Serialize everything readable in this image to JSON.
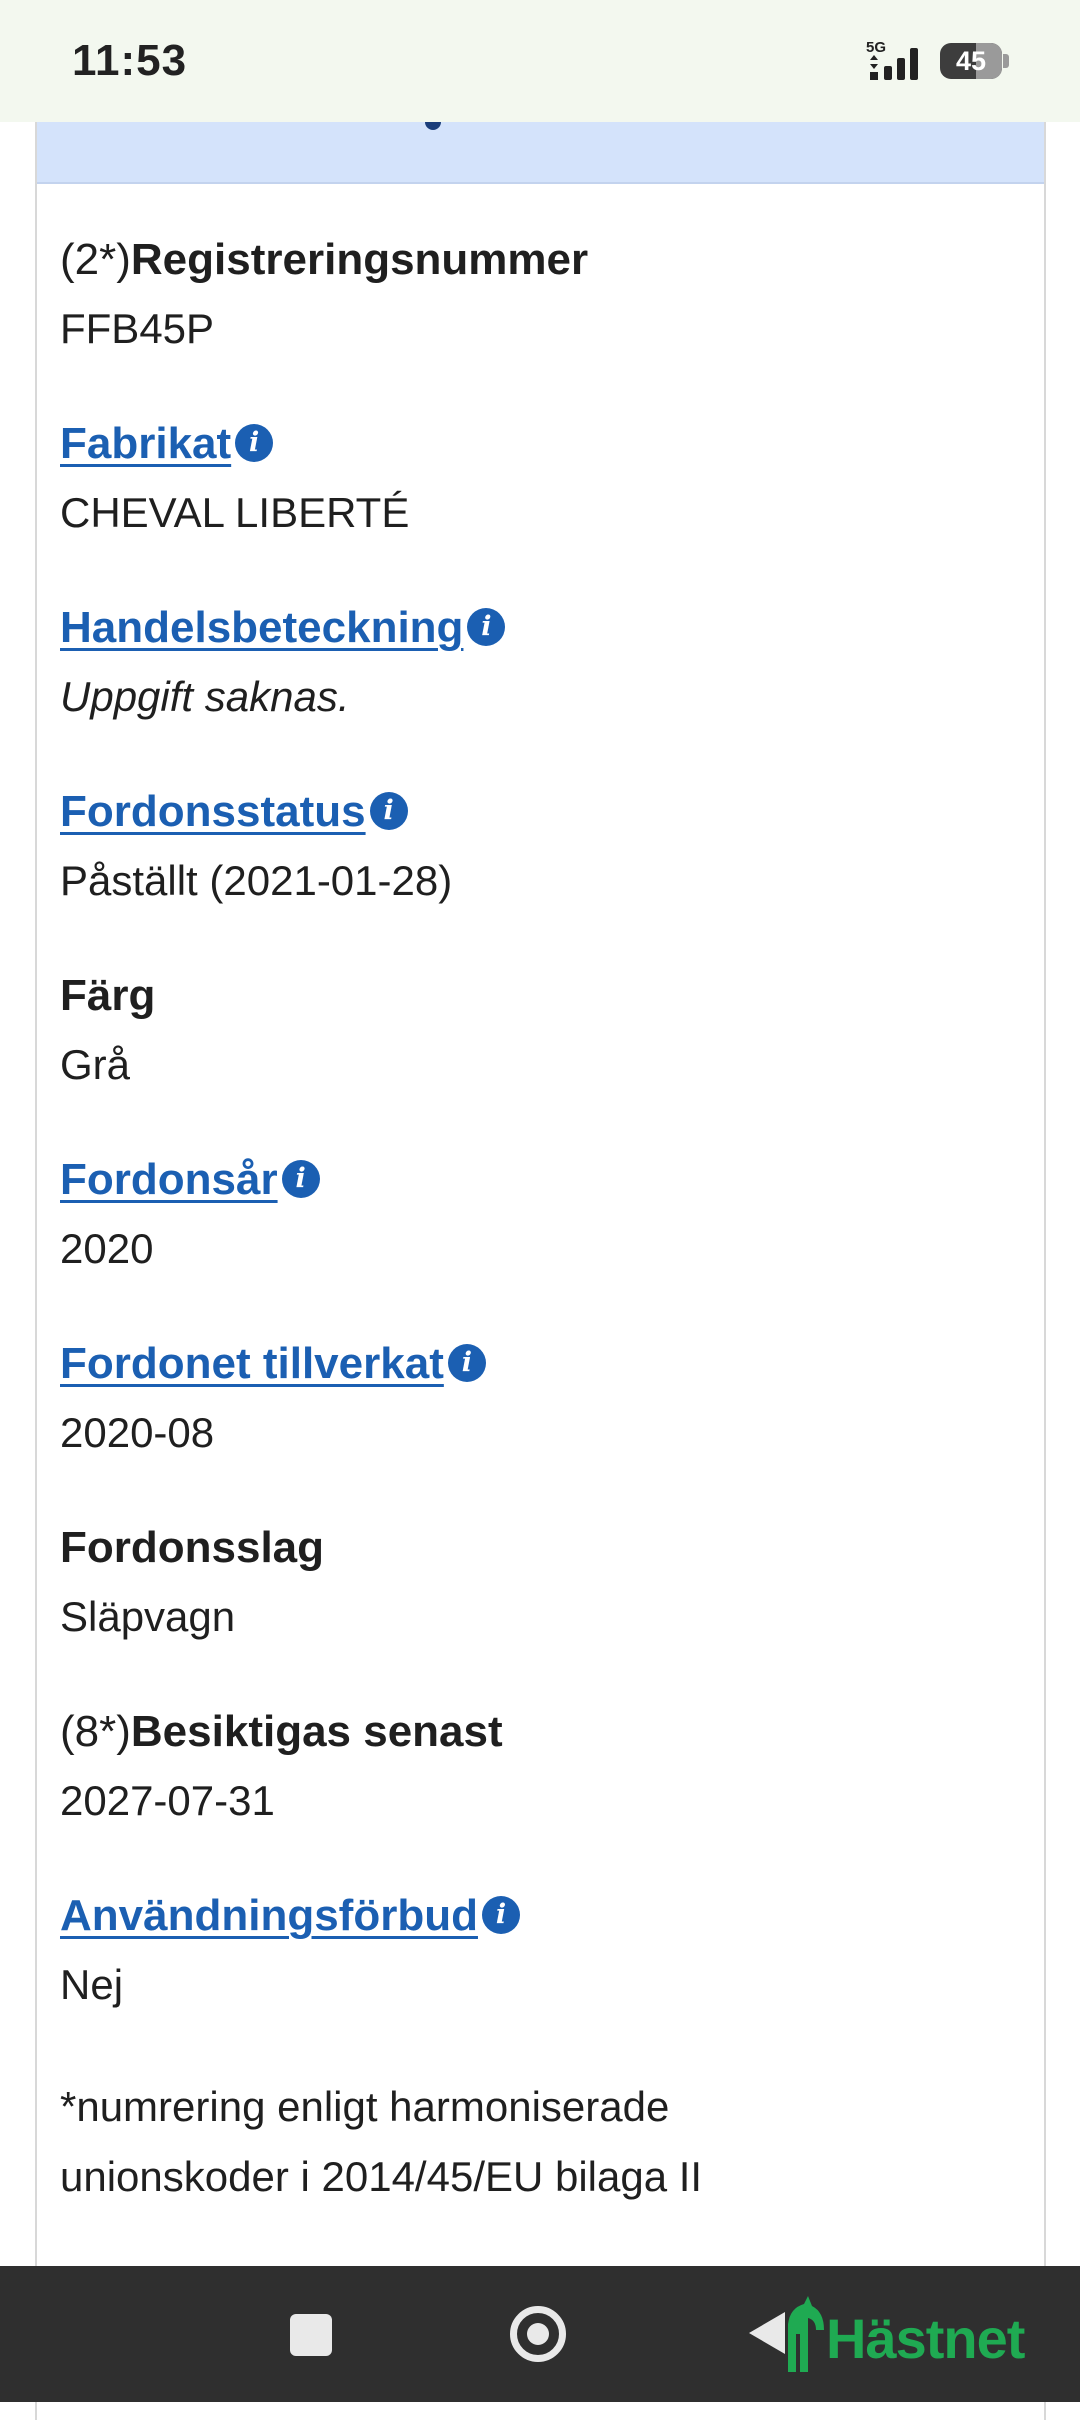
{
  "status_bar": {
    "time": "11:53",
    "network": "5G",
    "battery": "45"
  },
  "fields": [
    {
      "prefix": "(2*)",
      "label": "Registreringsnummer",
      "link": false,
      "info": false,
      "value": "FFB45P",
      "italic": false
    },
    {
      "prefix": "",
      "label": "Fabrikat",
      "link": true,
      "info": true,
      "value": "CHEVAL LIBERTÉ",
      "italic": false
    },
    {
      "prefix": "",
      "label": "Handelsbeteckning",
      "link": true,
      "info": true,
      "value": "Uppgift saknas.",
      "italic": true
    },
    {
      "prefix": "",
      "label": "Fordonsstatus",
      "link": true,
      "info": true,
      "value": "Påställt (2021-01-28)",
      "italic": false
    },
    {
      "prefix": "",
      "label": "Färg",
      "link": false,
      "info": false,
      "value": "Grå",
      "italic": false
    },
    {
      "prefix": "",
      "label": "Fordonsår",
      "link": true,
      "info": true,
      "value": "2020",
      "italic": false
    },
    {
      "prefix": "",
      "label": "Fordonet tillverkat",
      "link": true,
      "info": true,
      "value": "2020-08",
      "italic": false
    },
    {
      "prefix": "",
      "label": "Fordonsslag",
      "link": false,
      "info": false,
      "value": "Släpvagn",
      "italic": false
    },
    {
      "prefix": "(8*)",
      "label": "Besiktigas senast",
      "link": false,
      "info": false,
      "value": "2027-07-31",
      "italic": false
    },
    {
      "prefix": "",
      "label": "Användningsförbud",
      "link": true,
      "info": true,
      "value": "Nej",
      "italic": false
    }
  ],
  "footnote": {
    "line1": "*numrering enligt harmoniserade",
    "line2": "unionskoder i 2014/45/EU bilaga II"
  },
  "info_icon_glyph": "i",
  "navbar": {
    "brand": "Hästnet"
  },
  "colors": {
    "link": "#1b5fb2",
    "header_band": "#d4e3fb",
    "brand": "#1faa52",
    "status_bg": "#f3f8ef",
    "nav_bg": "#2f2f2f"
  }
}
